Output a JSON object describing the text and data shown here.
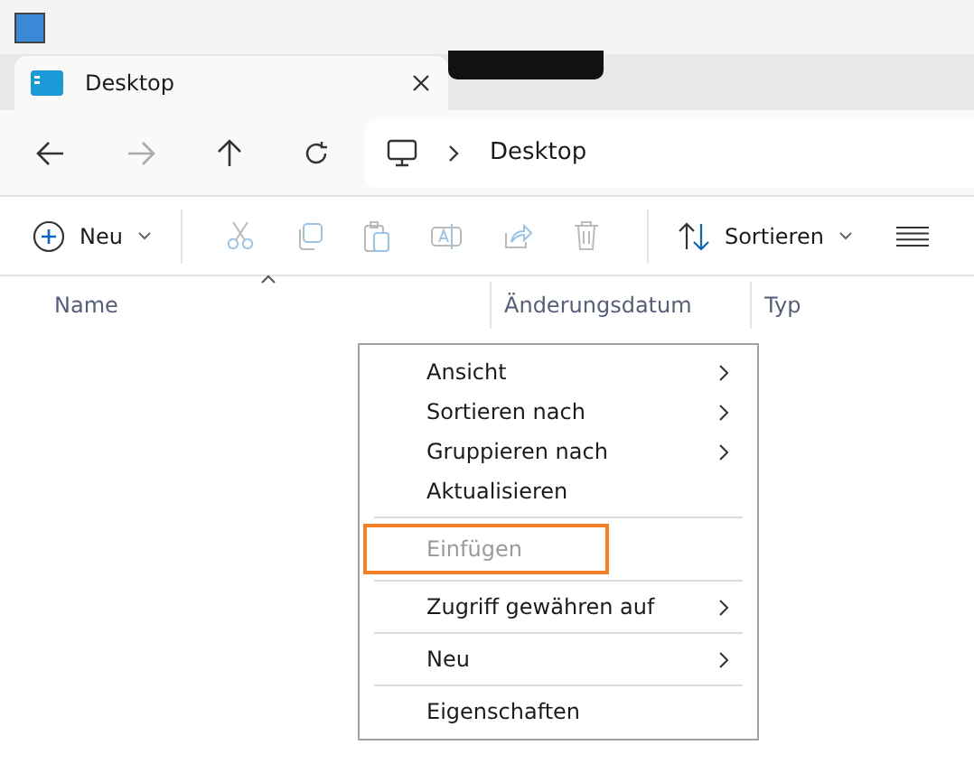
{
  "tabs": [
    {
      "label": "Desktop",
      "selected": true
    }
  ],
  "address": {
    "crumbs": [
      "Desktop"
    ]
  },
  "nav": {
    "back_disabled": false,
    "forward_disabled": true
  },
  "toolbar": {
    "new_label": "Neu",
    "sort_label": "Sortieren"
  },
  "columns": [
    {
      "label": "Name",
      "sorted": true
    },
    {
      "label": "Änderungsdatum",
      "sorted": false
    },
    {
      "label": "Typ",
      "sorted": false
    }
  ],
  "context_menu": [
    {
      "kind": "item",
      "label": "Ansicht",
      "submenu": true,
      "disabled": false,
      "highlighted": false
    },
    {
      "kind": "item",
      "label": "Sortieren nach",
      "submenu": true,
      "disabled": false,
      "highlighted": false
    },
    {
      "kind": "item",
      "label": "Gruppieren nach",
      "submenu": true,
      "disabled": false,
      "highlighted": false
    },
    {
      "kind": "item",
      "label": "Aktualisieren",
      "submenu": false,
      "disabled": false,
      "highlighted": false
    },
    {
      "kind": "separator"
    },
    {
      "kind": "item",
      "label": "Einfügen",
      "submenu": false,
      "disabled": true,
      "highlighted": true
    },
    {
      "kind": "separator"
    },
    {
      "kind": "item",
      "label": "Zugriff gewähren auf",
      "submenu": true,
      "disabled": false,
      "highlighted": false
    },
    {
      "kind": "separator"
    },
    {
      "kind": "item",
      "label": "Neu",
      "submenu": true,
      "disabled": false,
      "highlighted": false
    },
    {
      "kind": "separator"
    },
    {
      "kind": "item",
      "label": "Eigenschaften",
      "submenu": false,
      "disabled": false,
      "highlighted": false
    }
  ]
}
